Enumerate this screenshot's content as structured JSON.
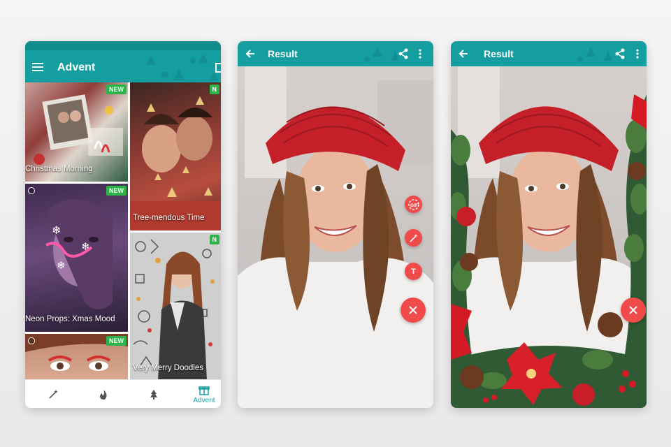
{
  "advent_screen": {
    "title": "Advent",
    "tiles": [
      {
        "caption": "Christmas Morning",
        "badge": "NEW"
      },
      {
        "caption": "Tree-mendous Time",
        "badge": "N"
      },
      {
        "caption": "Neon Props: Xmas Mood",
        "badge": "NEW"
      },
      {
        "caption": "Very Merry Doodles",
        "badge": "N"
      },
      {
        "caption": "",
        "badge": "NEW"
      }
    ],
    "nav": {
      "active_label": "Advent"
    }
  },
  "result_screen_1": {
    "title": "Result",
    "actions": {
      "gif_label": "GIF",
      "text_label": "T"
    }
  },
  "result_screen_2": {
    "title": "Result"
  },
  "colors": {
    "toolbar": "#159ea0",
    "fab": "#f04a4a",
    "badge": "#2db34a"
  },
  "icons": [
    "menu-icon",
    "back-arrow-icon",
    "share-icon",
    "more-vert-icon",
    "magic-wand-icon",
    "fire-icon",
    "tree-icon",
    "gift-icon",
    "close-icon",
    "text-icon",
    "gif-icon"
  ]
}
